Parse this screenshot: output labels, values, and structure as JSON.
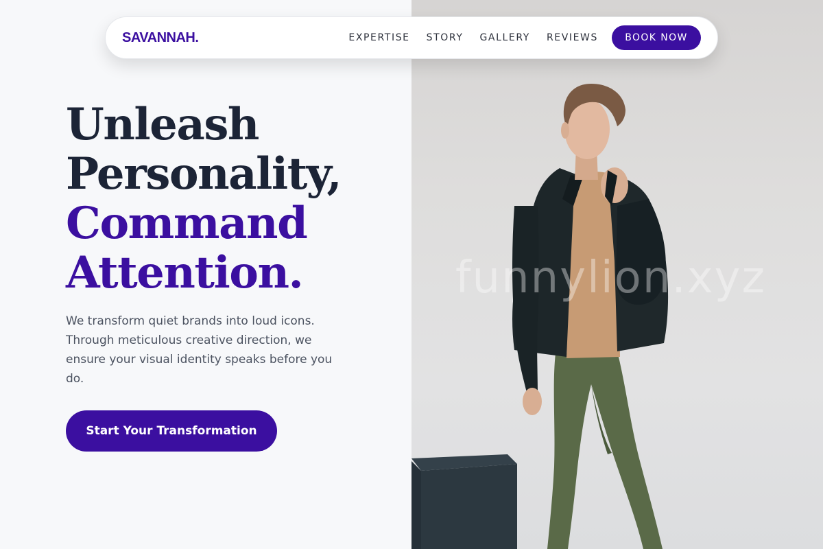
{
  "brand": {
    "logo_text": "SAVANNAH.",
    "accent_color": "#3b0fa0",
    "heading_color": "#1c2436"
  },
  "nav": {
    "links": [
      {
        "label": "EXPERTISE"
      },
      {
        "label": "STORY"
      },
      {
        "label": "GALLERY"
      },
      {
        "label": "REVIEWS"
      }
    ],
    "cta_label": "BOOK NOW"
  },
  "hero": {
    "title_lines": [
      "Unleash",
      "Personality,",
      "Command",
      "Attention."
    ],
    "description": "We transform quiet brands into loud icons. Through meticulous creative direction, we ensure your visual identity speaks before you do.",
    "cta_label": "Start Your Transformation"
  },
  "image": {
    "watermark_text": "funnylion.xyz"
  }
}
